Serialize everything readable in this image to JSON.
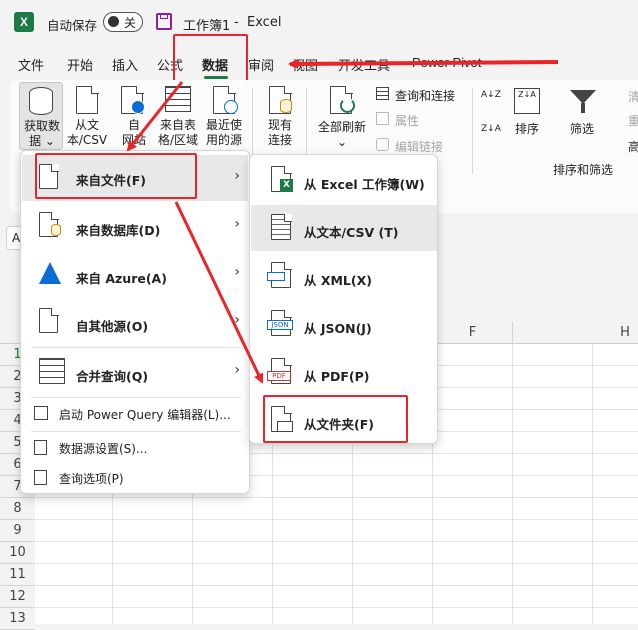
{
  "titlebar": {
    "autosave_label": "自动保存",
    "autosave_state": "关",
    "doc_title": "工作簿1",
    "separator": "-",
    "app_name": "Excel"
  },
  "tabs": [
    "文件",
    "开始",
    "插入",
    "公式",
    "数据",
    "审阅",
    "视图",
    "开发工具",
    "Power Pivot"
  ],
  "ribbon": {
    "get_data": [
      "获取数",
      "据 ⌄"
    ],
    "from_text_csv": [
      "从文",
      "本/CSV"
    ],
    "from_web": [
      "自",
      "网站"
    ],
    "from_table": [
      "来自表",
      "格/区域"
    ],
    "recent_sources": [
      "最近使",
      "用的源"
    ],
    "existing_conn": [
      "现有",
      "连接"
    ],
    "refresh_all": [
      "全部刷新",
      "⌄"
    ],
    "queries_conn": "查询和连接",
    "properties": "属性",
    "edit_links": "编辑链接",
    "sort": "排序",
    "filter": "筛选",
    "sort_filter_group": "排序和筛选",
    "clear": "清",
    "reapply": "重",
    "advanced": "高"
  },
  "name_box_initial": "A",
  "columns": [
    "F",
    "H"
  ],
  "rows": [
    "1",
    "2",
    "3",
    "4",
    "5",
    "6",
    "7",
    "8",
    "9",
    "10",
    "11",
    "12",
    "13"
  ],
  "menu1": [
    {
      "label": "来自文件(F)"
    },
    {
      "label": "来自数据库(D)"
    },
    {
      "label": "来自 Azure(A)"
    },
    {
      "label": "自其他源(O)"
    },
    {
      "label": "合并查询(Q)"
    },
    {
      "label": "启动 Power Query 编辑器(L)..."
    },
    {
      "label": "数据源设置(S)..."
    },
    {
      "label": "查询选项(P)"
    }
  ],
  "menu2": [
    {
      "label": "从 Excel 工作簿(W)"
    },
    {
      "label": "从文本/CSV (T)"
    },
    {
      "label": "从 XML(X)"
    },
    {
      "label": "从 JSON(J)"
    },
    {
      "label": "从 PDF(P)"
    },
    {
      "label": "从文件夹(F)"
    }
  ],
  "icon_text": {
    "json": "JSON",
    "pdf": "PDF",
    "excel_x": "X",
    "sort_az": "A↓Z",
    "sort_za": "Z↓A"
  },
  "colors": {
    "excel_green": "#1d7a45",
    "highlight_red": "#e8262a",
    "azure_blue": "#0a6cd6"
  }
}
